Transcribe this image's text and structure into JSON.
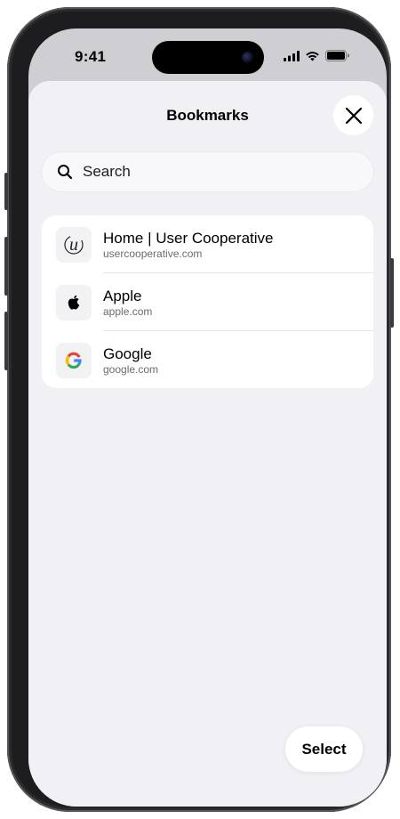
{
  "status_bar": {
    "time": "9:41",
    "icons": [
      "cellular-signal-icon",
      "wifi-icon",
      "battery-icon"
    ]
  },
  "sheet": {
    "title": "Bookmarks",
    "close_icon": "close-icon"
  },
  "search": {
    "placeholder": "Search",
    "value": "",
    "icon": "search-icon"
  },
  "bookmarks": [
    {
      "title": "Home | User Cooperative",
      "url": "usercooperative.com",
      "icon": "user-cooperative-logo-icon"
    },
    {
      "title": "Apple",
      "url": "apple.com",
      "icon": "apple-logo-icon"
    },
    {
      "title": "Google",
      "url": "google.com",
      "icon": "google-logo-icon"
    }
  ],
  "footer": {
    "select_label": "Select"
  },
  "colors": {
    "sheet_background": "#f0f0f5",
    "card_background": "#ffffff",
    "separator": "#e3e3e8",
    "secondary_text": "#6b6b70"
  }
}
